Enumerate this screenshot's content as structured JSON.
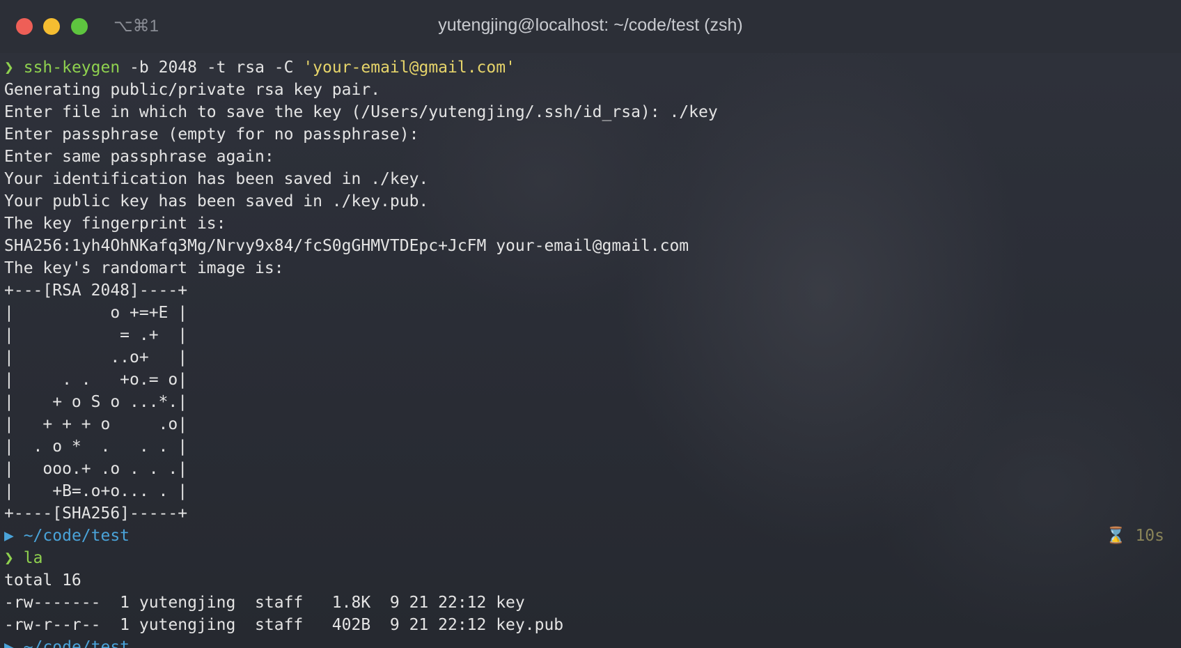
{
  "window": {
    "title": "yutengjing@localhost: ~/code/test (zsh)",
    "tab_shortcut": "⌥⌘1"
  },
  "terminal": {
    "cmd1": {
      "prompt": "❯",
      "command": "ssh-keygen",
      "args": " -b 2048 -t rsa -C ",
      "string_arg": "'your-email@gmail.com'"
    },
    "output1": [
      "Generating public/private rsa key pair.",
      "Enter file in which to save the key (/Users/yutengjing/.ssh/id_rsa): ./key",
      "Enter passphrase (empty for no passphrase):",
      "Enter same passphrase again:",
      "Your identification has been saved in ./key.",
      "Your public key has been saved in ./key.pub.",
      "The key fingerprint is:",
      "SHA256:1yh4OhNKafq3Mg/Nrvy9x84/fcS0gGHMVTDEpc+JcFM your-email@gmail.com",
      "The key's randomart image is:",
      "+---[RSA 2048]----+",
      "|          o +=+E |",
      "|           = .+  |",
      "|          ..o+   |",
      "|     . .   +o.= o|",
      "|    + o S o ...*.|",
      "|   + + + o     .o|",
      "|  . o *  .   . . |",
      "|   ooo.+ .o . . .|",
      "|    +B=.o+o... . |",
      "+----[SHA256]-----+"
    ],
    "prompt_dir": {
      "icon": "folder-icon",
      "glyph": "▶",
      "path": " ~/code/test",
      "duration": "⌛ 10s"
    },
    "cmd2": {
      "prompt": "❯",
      "command": "la"
    },
    "output2": [
      "total 16",
      "-rw-------  1 yutengjing  staff   1.8K  9 21 22:12 key",
      "-rw-r--r--  1 yutengjing  staff   402B  9 21 22:12 key.pub"
    ],
    "prompt_dir2": {
      "path": " ~/code/test"
    }
  }
}
